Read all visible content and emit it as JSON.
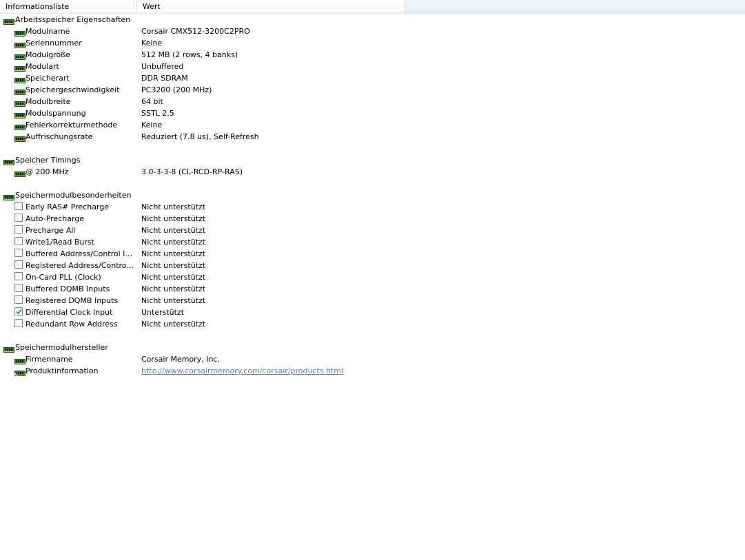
{
  "columns": {
    "col1": "Informationsliste",
    "col2": "Wert"
  },
  "groups": [
    {
      "title": "Arbeitsspeicher Eigenschaften",
      "icon": "memory-module-icon",
      "items": [
        {
          "label": "Modulname",
          "value": "Corsair CMX512-3200C2PRO"
        },
        {
          "label": "Seriennummer",
          "value": "Keine"
        },
        {
          "label": "Modulgröße",
          "value": "512 MB (2 rows, 4 banks)"
        },
        {
          "label": "Modulart",
          "value": "Unbuffered"
        },
        {
          "label": "Speicherart",
          "value": "DDR SDRAM"
        },
        {
          "label": "Speichergeschwindigkeit",
          "value": "PC3200 (200 MHz)"
        },
        {
          "label": "Modulbreite",
          "value": "64 bit"
        },
        {
          "label": "Modulspannung",
          "value": "SSTL 2.5"
        },
        {
          "label": "Fehlerkorrekturmethode",
          "value": "Keine"
        },
        {
          "label": "Auffrischungsrate",
          "value": "Reduziert (7.8 us), Self-Refresh"
        }
      ]
    },
    {
      "title": "Speicher Timings",
      "icon": "memory-module-icon",
      "items": [
        {
          "label": "@ 200 MHz",
          "value": "3.0-3-3-8  (CL-RCD-RP-RAS)"
        }
      ]
    },
    {
      "title": "Speichermodulbesonderheiten",
      "icon": "memory-module-icon",
      "features": [
        {
          "label": "Early RAS# Precharge",
          "value": "Nicht unterstützt",
          "checked": false
        },
        {
          "label": "Auto-Precharge",
          "value": "Nicht unterstützt",
          "checked": false
        },
        {
          "label": "Precharge All",
          "value": "Nicht unterstützt",
          "checked": false
        },
        {
          "label": "Write1/Read Burst",
          "value": "Nicht unterstützt",
          "checked": false
        },
        {
          "label": "Buffered Address/Control Inputs",
          "value": "Nicht unterstützt",
          "checked": false
        },
        {
          "label": "Registered Address/Control In...",
          "value": "Nicht unterstützt",
          "checked": false
        },
        {
          "label": "On-Card PLL (Clock)",
          "value": "Nicht unterstützt",
          "checked": false
        },
        {
          "label": "Buffered DQMB Inputs",
          "value": "Nicht unterstützt",
          "checked": false
        },
        {
          "label": "Registered DQMB Inputs",
          "value": "Nicht unterstützt",
          "checked": false
        },
        {
          "label": "Differential Clock Input",
          "value": "Unterstützt",
          "checked": true
        },
        {
          "label": "Redundant Row Address",
          "value": "Nicht unterstützt",
          "checked": false
        }
      ]
    },
    {
      "title": "Speichermodulhersteller",
      "icon": "memory-module-icon",
      "items": [
        {
          "label": "Firmenname",
          "value": "Corsair Memory, Inc."
        },
        {
          "label": "Produktinformation",
          "value": "http://www.corsairmemory.com/corsair/products.html",
          "link": true
        }
      ]
    }
  ],
  "colors": {
    "link": "#5b82b6",
    "icon_green": "#2f7d1e",
    "header_highlight": "#e8f1fa"
  }
}
